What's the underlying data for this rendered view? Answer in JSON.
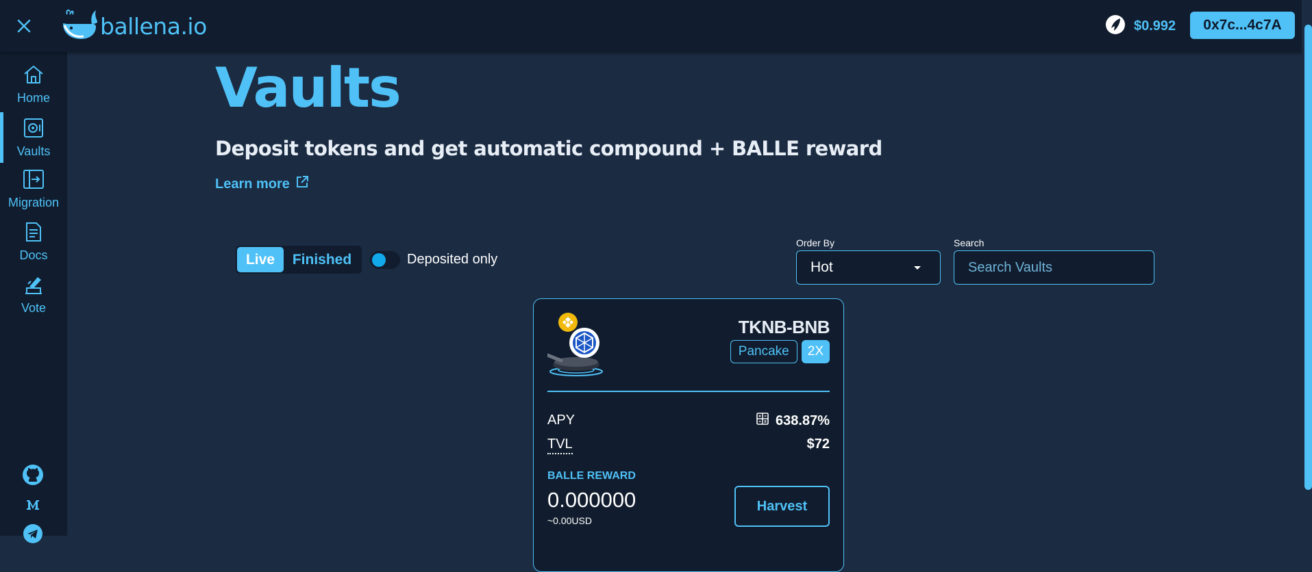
{
  "header": {
    "brand_name": "ballena.io",
    "token_price": "$0.992",
    "wallet_address": "0x7c...4c7A",
    "icons": [
      "close-icon",
      "whale-logo-icon",
      "balle-token-icon"
    ]
  },
  "sidebar": {
    "items": [
      {
        "label": "Home",
        "icon": "home-icon"
      },
      {
        "label": "Vaults",
        "icon": "vault-icon",
        "active": true
      },
      {
        "label": "Migration",
        "icon": "migration-icon"
      },
      {
        "label": "Docs",
        "icon": "docs-icon"
      },
      {
        "label": "Vote",
        "icon": "vote-icon"
      }
    ],
    "social": [
      "github-icon",
      "medium-icon",
      "telegram-icon"
    ]
  },
  "page": {
    "title": "Vaults",
    "subtitle": "Deposit tokens and get automatic compound + BALLE reward",
    "learn_more": "Learn more"
  },
  "filters": {
    "tabs": {
      "live": "Live",
      "finished": "Finished",
      "selected": "Live"
    },
    "deposited_only": {
      "label": "Deposited only",
      "on": false
    },
    "order_by": {
      "label": "Order By",
      "value": "Hot"
    },
    "search": {
      "label": "Search",
      "placeholder": "Search Vaults",
      "value": ""
    }
  },
  "vault": {
    "name": "TKNB-BNB",
    "platform": "Pancake",
    "multiplier": "2X",
    "apy_label": "APY",
    "apy_value": "638.87%",
    "tvl_label": "TVL",
    "tvl_value": "$72",
    "reward_title": "BALLE REWARD",
    "reward_value": "0.000000",
    "reward_usd": "~0.00USD",
    "harvest_label": "Harvest",
    "icons": [
      "bnb-icon",
      "token-icon",
      "calculator-icon"
    ]
  },
  "colors": {
    "accent": "#4fc1f7",
    "background": "#1b2b42",
    "panel": "#111d2e",
    "bnb": "#f0b90b"
  }
}
